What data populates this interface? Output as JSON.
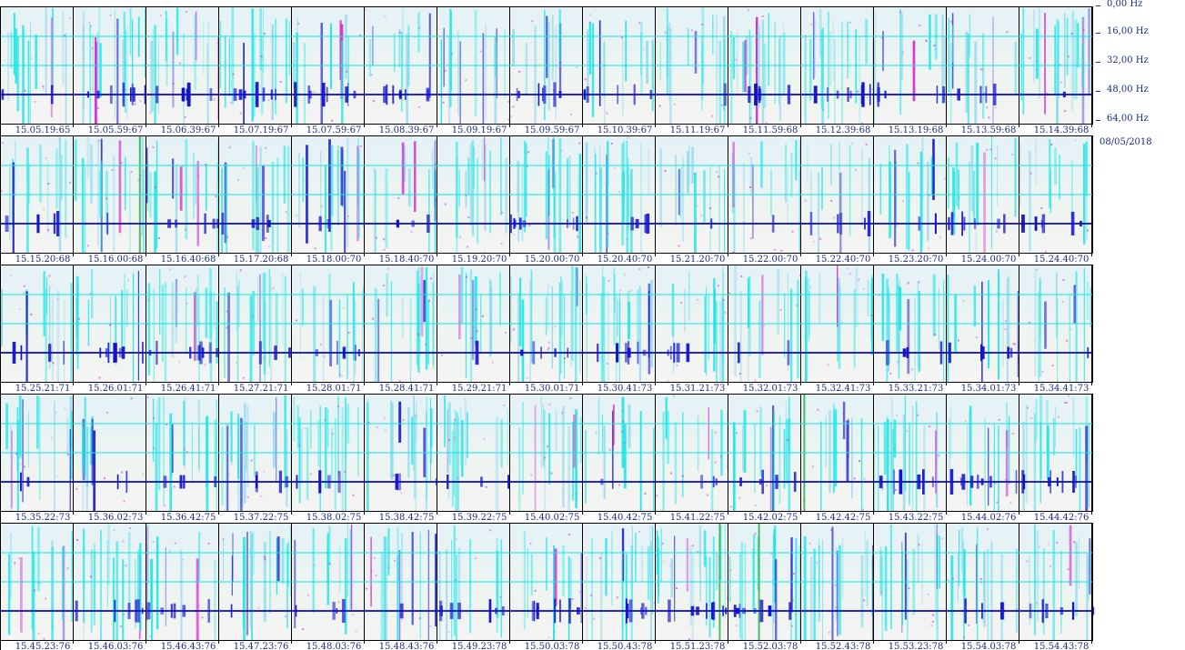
{
  "chart_data": {
    "type": "heatmap",
    "description_free": true,
    "date": "08/05/2018",
    "frequency_axis": {
      "unit": "Hz",
      "ticks": [
        "0,00 Hz",
        "16,00 Hz",
        "32,00 Hz",
        "48,00 Hz",
        "64,00 Hz"
      ],
      "range": [
        0,
        64
      ]
    },
    "colors": {
      "background": "#eef3ee",
      "cyan": "#19e6e6",
      "blue": "#1111c8",
      "magenta": "#d020d0",
      "green": "#20b040",
      "frame": "#000000",
      "label": "#1a2a8a"
    },
    "rows": [
      {
        "labels": [
          "15.05.19:65",
          "15.05.59:67",
          "15.06.39:67",
          "15.07.19:67",
          "15.07.59:67",
          "15.08.39:67",
          "15.09.19:67",
          "15.09.59:67",
          "15.10.39:67",
          "15.11.19:67",
          "15.11.59:68",
          "15.12.39:68",
          "15.13.19:68",
          "15.13.59:68",
          "15.14.39:68"
        ]
      },
      {
        "labels": [
          "15.15.20:68",
          "15.16.00:68",
          "15.16.40:68",
          "15.17.20:68",
          "15.18.00:70",
          "15.18.40:70",
          "15.19.20:70",
          "15.20.00:70",
          "15.20.40:70",
          "15.21.20:70",
          "15.22.00:70",
          "15.22.40:70",
          "15.23.20:70",
          "15.24.00:70",
          "15.24.40:70"
        ]
      },
      {
        "labels": [
          "15.25.21:71",
          "15.26.01:71",
          "15.26.41:71",
          "15.27.21:71",
          "15.28.01:71",
          "15.28.41:71",
          "15.29.21:71",
          "15.30.01:71",
          "15.30.41:73",
          "15.31.21:73",
          "15.32.01:73",
          "15.32.41:73",
          "15.33.21:73",
          "15.34.01:73",
          "15.34.41:73"
        ]
      },
      {
        "labels": [
          "15.35.22:73",
          "15.36.02:73",
          "15.36.42:75",
          "15.37.22:75",
          "15.38.02:75",
          "15.38.42:75",
          "15.39.22:75",
          "15.40.02:75",
          "15.40.42:75",
          "15.41.22:75",
          "15.42.02:75",
          "15.42.42:75",
          "15.43.22:75",
          "15.44.02:76",
          "15.44.42:76"
        ]
      },
      {
        "labels": [
          "15.45.23:76",
          "15.46.03:76",
          "15.46.43:76",
          "15.47.23:76",
          "15.48.03:76",
          "15.48.43:76",
          "15.49.23:78",
          "15.50.03:78",
          "15.50.43:78",
          "15.51.23:78",
          "15.52.03:78",
          "15.52.43:78",
          "15.53.23:78",
          "15.54.03:78",
          "15.54.43:78"
        ]
      }
    ]
  }
}
